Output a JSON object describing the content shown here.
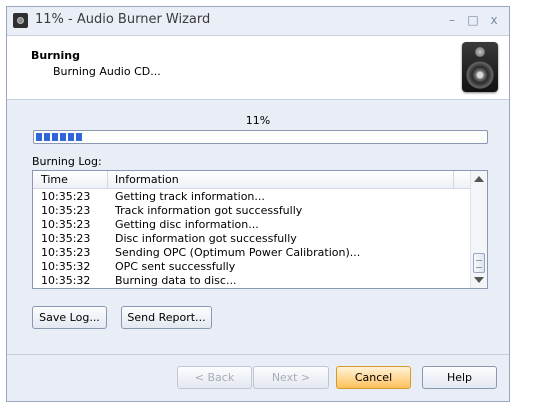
{
  "window": {
    "title": "11% - Audio Burner Wizard",
    "controls": {
      "minimize": "–",
      "maximize": "□",
      "close": "x"
    }
  },
  "header": {
    "title": "Burning",
    "subtitle": "Burning Audio CD..."
  },
  "progress": {
    "percent_text": "11%",
    "value": 0.11
  },
  "log": {
    "label": "Burning Log:",
    "columns": {
      "time": "Time",
      "info": "Information"
    },
    "rows": [
      {
        "time": "10:35:23",
        "info": "Getting track information..."
      },
      {
        "time": "10:35:23",
        "info": "Track information got successfully"
      },
      {
        "time": "10:35:23",
        "info": "Getting disc information..."
      },
      {
        "time": "10:35:23",
        "info": "Disc information got successfully"
      },
      {
        "time": "10:35:23",
        "info": "Sending OPC (Optimum Power Calibration)..."
      },
      {
        "time": "10:35:32",
        "info": "OPC sent successfully"
      },
      {
        "time": "10:35:32",
        "info": "Burning data to disc..."
      }
    ]
  },
  "buttons": {
    "save_log": "Save Log...",
    "send_report": "Send Report...",
    "back": "< Back",
    "next": "Next >",
    "cancel": "Cancel",
    "help": "Help"
  },
  "icons": {
    "app": "speaker-app-icon",
    "header": "speaker-icon"
  }
}
